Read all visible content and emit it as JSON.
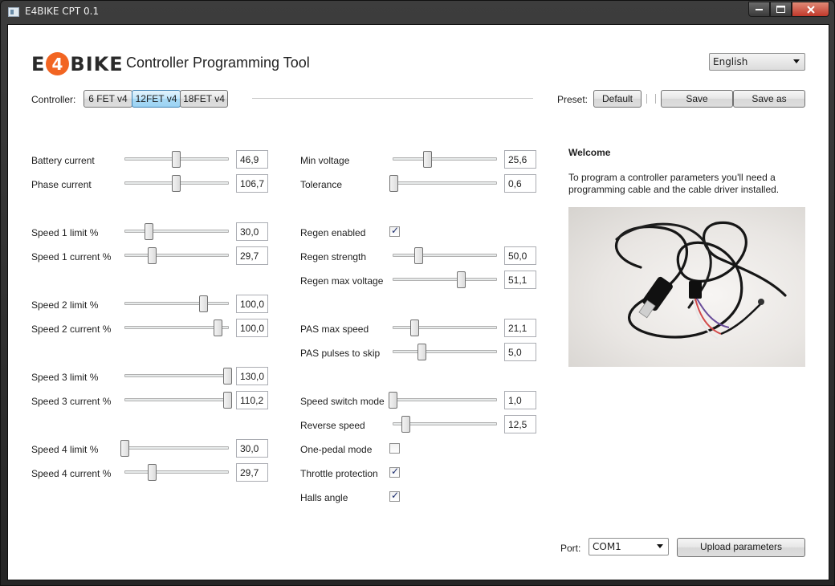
{
  "window": {
    "title": "E4BIKE CPT 0.1"
  },
  "header": {
    "logo_left": "E",
    "logo_four": "4",
    "logo_right": "BIKE",
    "title": "Controller Programming Tool"
  },
  "language": {
    "selected": "English"
  },
  "controller": {
    "label": "Controller:",
    "options": [
      "6 FET v4",
      "12FET v4",
      "18FET v4"
    ],
    "selected": "12FET v4"
  },
  "preset": {
    "label": "Preset:",
    "default_label": "Default",
    "save_label": "Save",
    "save_as_label": "Save as"
  },
  "left_params": [
    {
      "label": "Battery current",
      "value": "46,9"
    },
    {
      "label": "Phase current",
      "value": "106,7"
    },
    {
      "label": "Speed 1 limit %",
      "value": "30,0"
    },
    {
      "label": "Speed 1 current %",
      "value": "29,7"
    },
    {
      "label": "Speed 2 limit %",
      "value": "100,0"
    },
    {
      "label": "Speed 2 current %",
      "value": "100,0"
    },
    {
      "label": "Speed 3 limit %",
      "value": "130,0"
    },
    {
      "label": "Speed 3 current %",
      "value": "110,2"
    },
    {
      "label": "Speed 4 limit %",
      "value": "30,0"
    },
    {
      "label": "Speed 4 current %",
      "value": "29,7"
    }
  ],
  "right_params": [
    {
      "label": "Min voltage",
      "value": "25,6"
    },
    {
      "label": "Tolerance",
      "value": "0,6"
    },
    {
      "label": "Regen enabled",
      "checked": true
    },
    {
      "label": "Regen strength",
      "value": "50,0"
    },
    {
      "label": "Regen max voltage",
      "value": "51,1"
    },
    {
      "label": "PAS max speed",
      "value": "21,1"
    },
    {
      "label": "PAS pulses to skip",
      "value": "5,0"
    },
    {
      "label": "Speed switch mode",
      "value": "1,0"
    },
    {
      "label": "Reverse speed",
      "value": "12,5"
    },
    {
      "label": "One-pedal mode",
      "checked": false
    },
    {
      "label": "Throttle protection",
      "checked": true
    },
    {
      "label": "Halls angle",
      "checked": true
    }
  ],
  "welcome": {
    "title": "Welcome",
    "text": "To program a controller parameters you'll need a programming cable and the cable driver installed."
  },
  "footer": {
    "port_label": "Port:",
    "port_selected": "COM1",
    "upload_label": "Upload parameters"
  }
}
